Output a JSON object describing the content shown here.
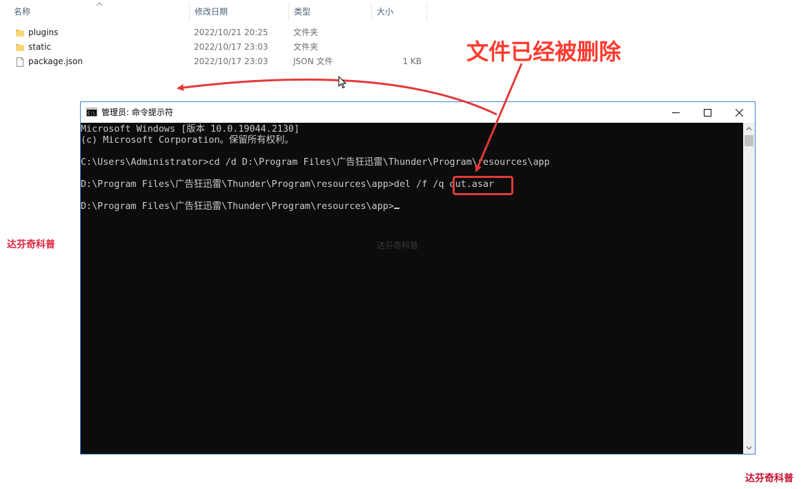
{
  "explorer": {
    "columns": {
      "name": "名称",
      "date": "修改日期",
      "type": "类型",
      "size": "大小"
    },
    "files": [
      {
        "name": "plugins",
        "date": "2022/10/21 20:25",
        "type": "文件夹",
        "size": "",
        "icon": "folder-icon"
      },
      {
        "name": "static",
        "date": "2022/10/17 23:03",
        "type": "文件夹",
        "size": "",
        "icon": "folder-icon"
      },
      {
        "name": "package.json",
        "date": "2022/10/17 23:03",
        "type": "JSON 文件",
        "size": "1 KB",
        "icon": "file-icon"
      }
    ],
    "colors": {
      "folder": "#f8d775",
      "header_text": "#4c607a"
    }
  },
  "cmd": {
    "title": "管理员: 命令提示符",
    "lines": [
      "Microsoft Windows [版本 10.0.19044.2130]",
      "(c) Microsoft Corporation。保留所有权利。",
      "",
      "C:\\Users\\Administrator>cd /d D:\\Program Files\\广告狂迅雷\\Thunder\\Program\\resources\\app",
      "",
      "D:\\Program Files\\广告狂迅雷\\Thunder\\Program\\resources\\app>del /f /q out.asar",
      "",
      "D:\\Program Files\\广告狂迅雷\\Thunder\\Program\\resources\\app>"
    ],
    "colors": {
      "background": "#0c0c0c",
      "text": "#cccccc",
      "border": "#3c7fd6"
    }
  },
  "annotation": {
    "title": "文件已经被删除",
    "color": "#ff3b2f"
  },
  "watermark": {
    "left": "达芬奇科普",
    "center": "达芬奇科普",
    "bottom_right": "达芬奇科普"
  }
}
